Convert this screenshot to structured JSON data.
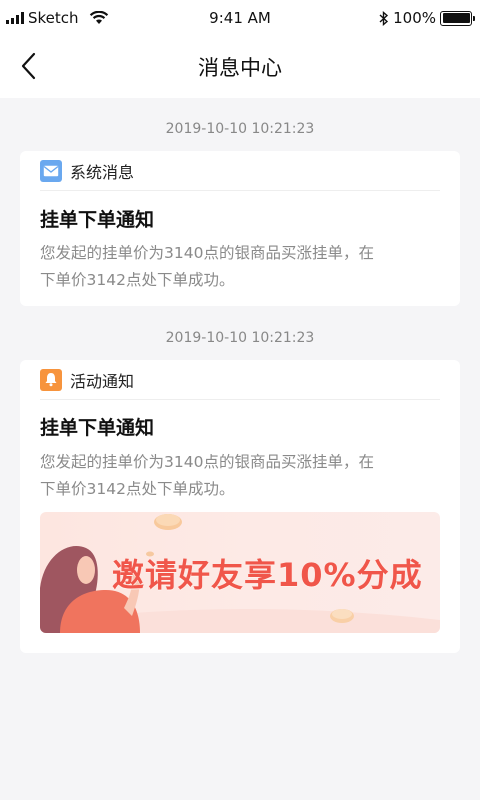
{
  "status_bar": {
    "carrier": "Sketch",
    "time": "9:41 AM",
    "battery": "100%",
    "battery_level": 1.0
  },
  "nav": {
    "title": "消息中心",
    "back_icon": "chevron-left-icon"
  },
  "messages": [
    {
      "timestamp": "2019-10-10  10:21:23",
      "category": "系统消息",
      "category_icon": "mail-icon",
      "icon_color": "#6aa8ef",
      "title": "挂单下单通知",
      "body_line1": "您发起的挂单价为3140点的银商品买涨挂单，在",
      "body_line2": "下单价3142点处下单成功。"
    },
    {
      "timestamp": "2019-10-10  10:21:23",
      "category": "活动通知",
      "category_icon": "bell-icon",
      "icon_color": "#f7943d",
      "title": "挂单下单通知",
      "body_line1": "您发起的挂单价为3140点的银商品买涨挂单，在",
      "body_line2": "下单价3142点处下单成功。",
      "banner": {
        "text": "邀请好友享10%分成",
        "text_color": "#f0564a"
      }
    }
  ],
  "colors": {
    "background": "#f5f5f7",
    "card": "#ffffff",
    "muted_text": "#8a8a8a"
  }
}
